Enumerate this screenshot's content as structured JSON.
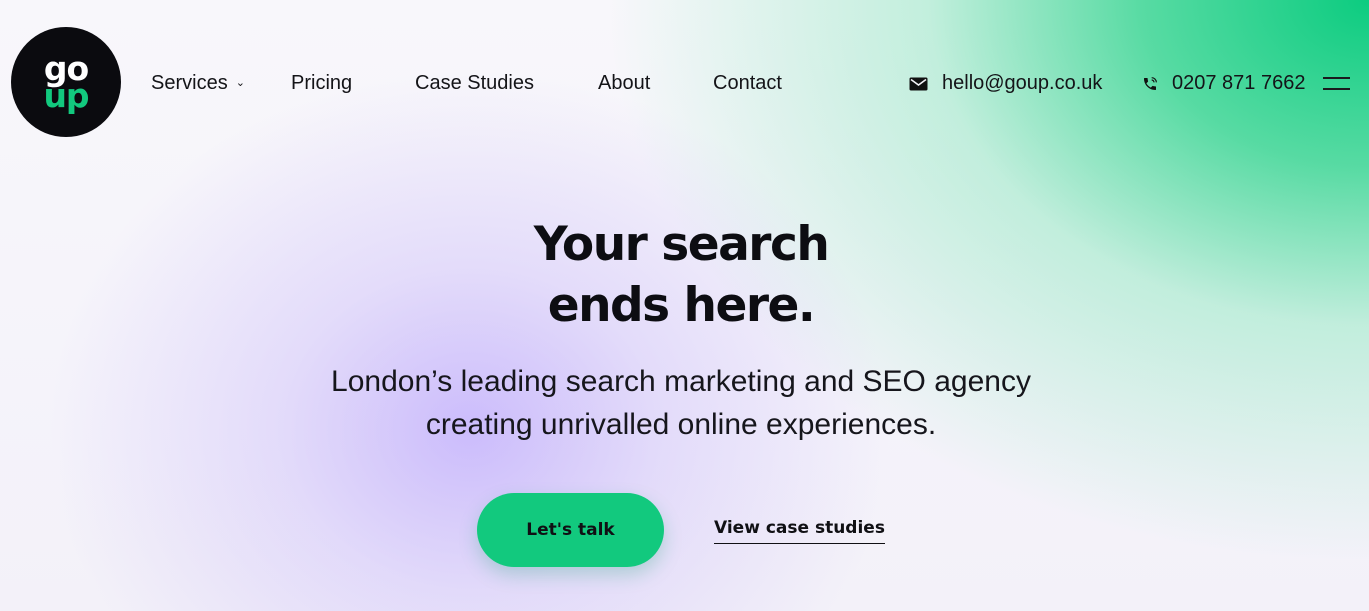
{
  "logo": {
    "top": "go",
    "bottom": "up"
  },
  "nav": {
    "items": [
      {
        "label": "Services",
        "has_dropdown": true
      },
      {
        "label": "Pricing"
      },
      {
        "label": "Case Studies"
      },
      {
        "label": "About"
      },
      {
        "label": "Contact"
      }
    ]
  },
  "contact": {
    "email": "hello@goup.co.uk",
    "phone": "0207 871 7662"
  },
  "icons": {
    "email": "envelope-icon",
    "phone": "phone-icon",
    "menu": "hamburger-menu-icon",
    "dropdown": "chevron-down-icon"
  },
  "hero": {
    "title_line1": "Your search",
    "title_line2": "ends here.",
    "subtitle_line1": "London’s leading search marketing and SEO agency",
    "subtitle_line2": "creating unrivalled online experiences.",
    "cta_label": "Let's talk",
    "secondary_label": "View case studies"
  },
  "colors": {
    "brand_green": "#12c97e",
    "logo_background": "#0b0b0f",
    "text": "#111111",
    "lavender_glow": "#c4b2fc"
  }
}
